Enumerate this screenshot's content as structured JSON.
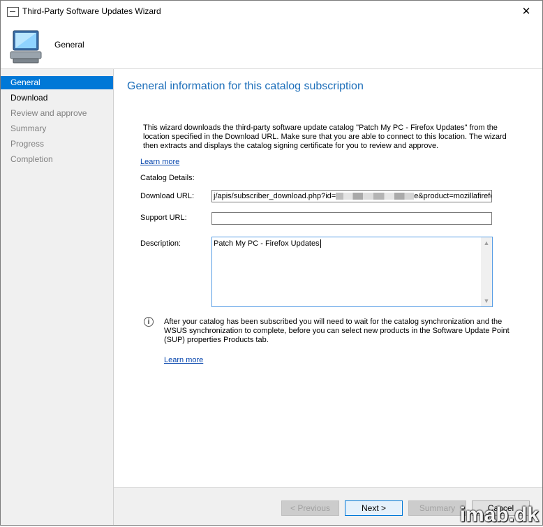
{
  "window": {
    "title": "Third-Party Software Updates Wizard",
    "close_glyph": "✕"
  },
  "header": {
    "label": "General"
  },
  "steps": [
    {
      "label": "General",
      "state": "active"
    },
    {
      "label": "Download",
      "state": "current"
    },
    {
      "label": "Review and approve",
      "state": "pending"
    },
    {
      "label": "Summary",
      "state": "pending"
    },
    {
      "label": "Progress",
      "state": "pending"
    },
    {
      "label": "Completion",
      "state": "pending"
    }
  ],
  "main": {
    "title": "General information for this catalog subscription",
    "intro": "This wizard downloads the third-party software update catalog \"Patch My PC - Firefox Updates\" from the location specified in the Download URL. Make sure that you are able to connect to this location. The wizard then extracts and displays the catalog signing certificate for you to review and approve.",
    "learn_more": "Learn more",
    "catalog_details_label": "Catalog Details:",
    "download_url_label": "Download URL:",
    "download_url_prefix": "j/apis/subscriber_download.php?id=",
    "download_url_suffix": "e&product=mozillafirefox",
    "support_url_label": "Support URL:",
    "support_url_value": "",
    "description_label": "Description:",
    "description_value": "Patch My PC - Firefox Updates",
    "info_text": "After your catalog has been subscribed you will need to wait for the catalog synchronization and the WSUS synchronization to complete, before you can select new products in the Software Update Point (SUP) properties Products tab.",
    "learn_more_2": "Learn more"
  },
  "footer": {
    "previous": "< Previous",
    "next": "Next >",
    "summary": "Summary",
    "cancel": "Cancel"
  },
  "watermark": "imab.dk",
  "icons": [
    "window-icon",
    "computer-icon",
    "info-icon",
    "close-icon"
  ],
  "colors": {
    "accent": "#0078d7",
    "title_blue": "#1e6fba",
    "link": "#0645ad"
  }
}
